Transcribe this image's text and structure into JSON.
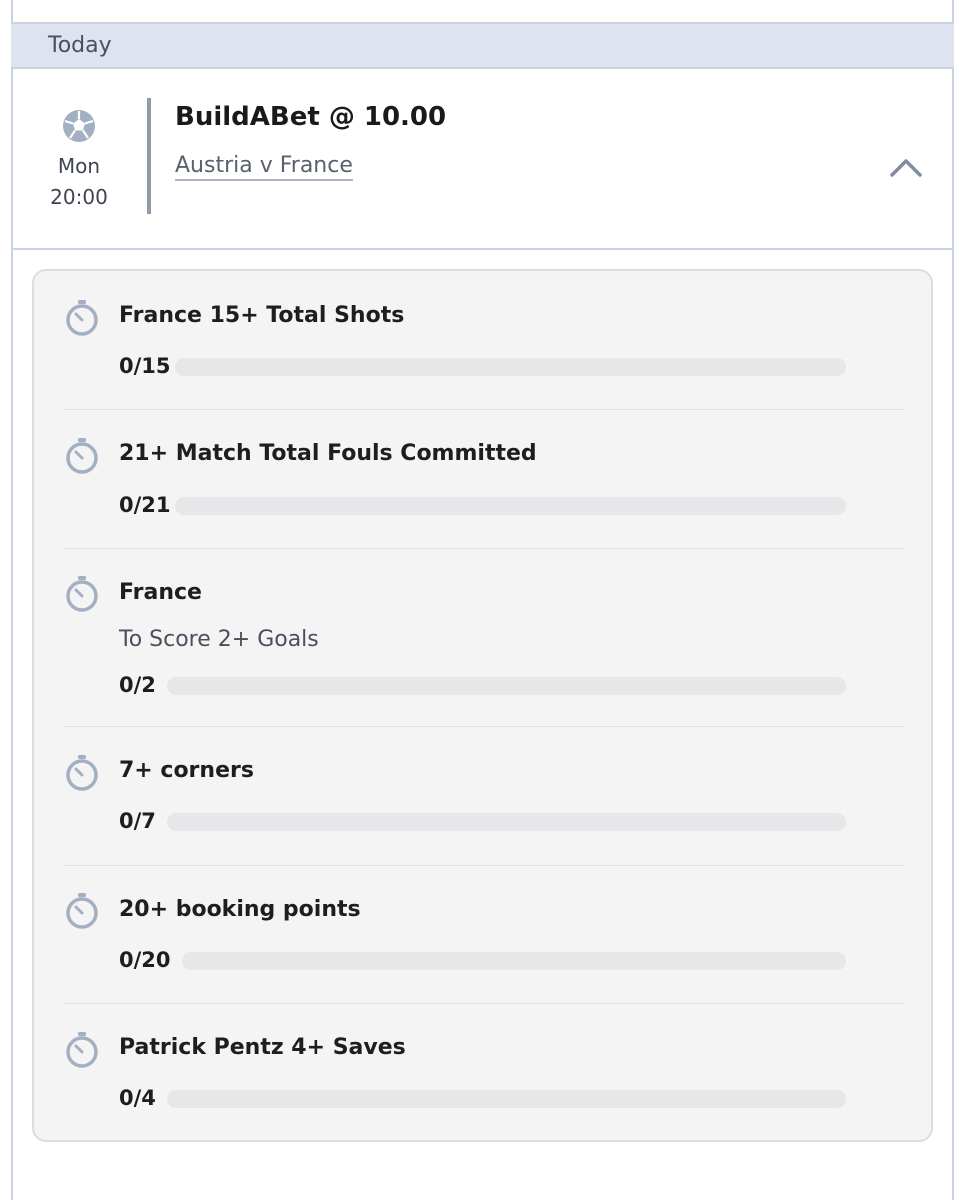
{
  "section": {
    "date_label": "Today"
  },
  "event": {
    "day": "Mon",
    "time": "20:00",
    "bet_title": "BuildABet @ 10.00",
    "match": "Austria v France"
  },
  "legs": [
    {
      "title": "France 15+ Total Shots",
      "subtitle": "",
      "progress_text": "0/15",
      "current": 0,
      "target": 15
    },
    {
      "title": "21+ Match Total Fouls Committed",
      "subtitle": "",
      "progress_text": "0/21",
      "current": 0,
      "target": 21
    },
    {
      "title": "France",
      "subtitle": "To Score 2+ Goals",
      "progress_text": "0/2",
      "current": 0,
      "target": 2
    },
    {
      "title": "7+ corners",
      "subtitle": "",
      "progress_text": "0/7",
      "current": 0,
      "target": 7
    },
    {
      "title": "20+ booking points",
      "subtitle": "",
      "progress_text": "0/20",
      "current": 0,
      "target": 20
    },
    {
      "title": "Patrick Pentz 4+ Saves",
      "subtitle": "",
      "progress_text": "0/4",
      "current": 0,
      "target": 4
    }
  ],
  "icons": {
    "sport": "football-icon",
    "leg": "stopwatch-icon",
    "toggle": "chevron-up-icon"
  },
  "colors": {
    "header_bg": "#dde4ef",
    "accent_bar": "#8f9aa8",
    "icon": "#a3b0c2",
    "track": "#e7e7ea"
  }
}
